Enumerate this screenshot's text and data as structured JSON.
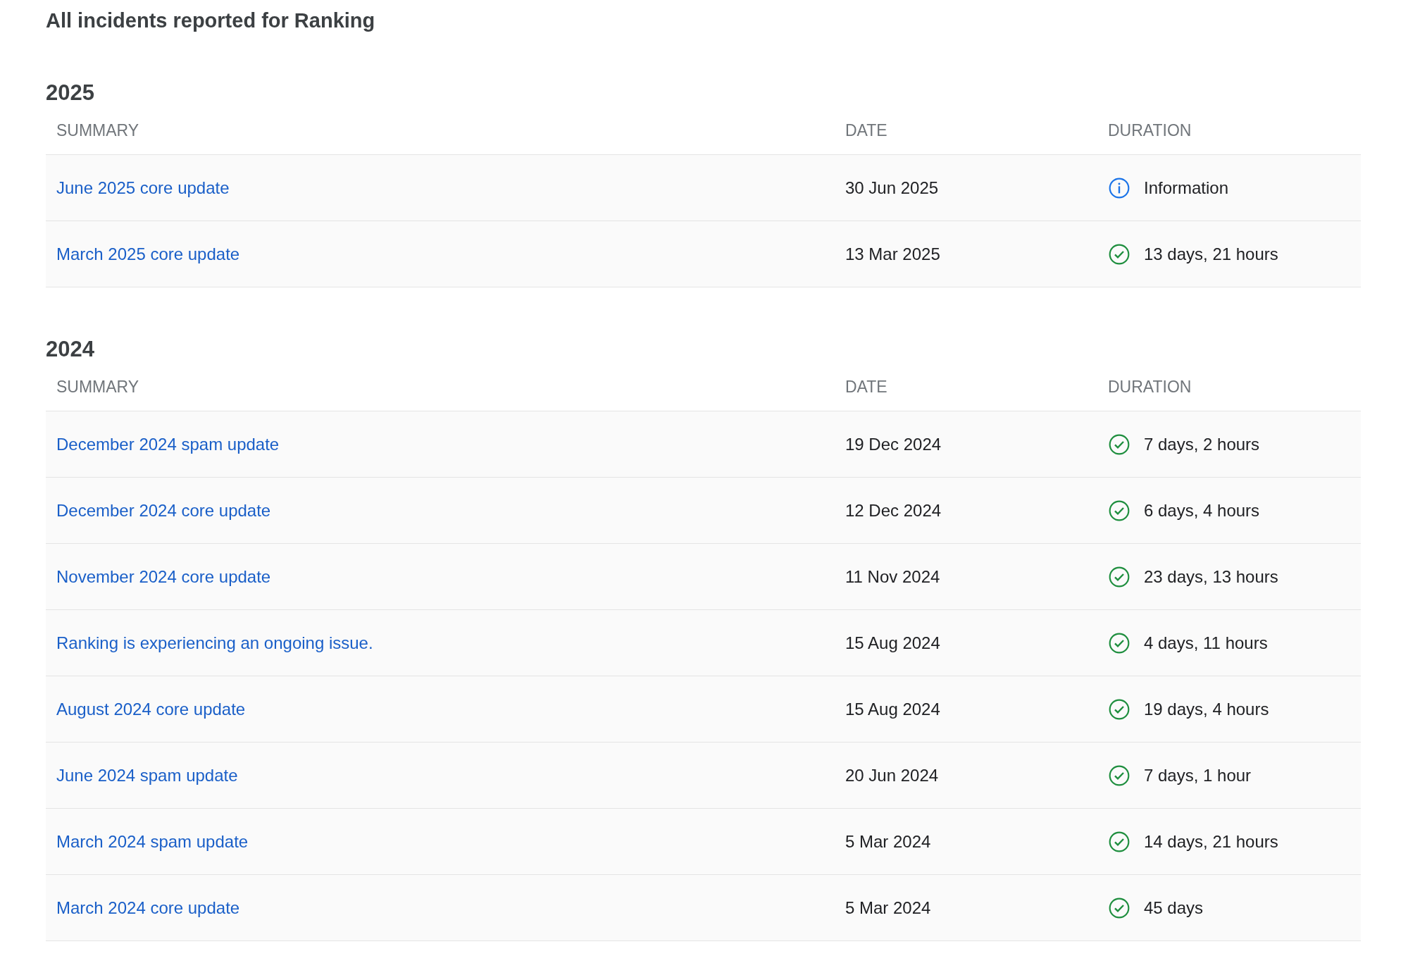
{
  "title": "All incidents reported for Ranking",
  "sections": [
    {
      "year": "2025",
      "columns": [
        "SUMMARY",
        "DATE",
        "DURATION"
      ],
      "rows": [
        {
          "summary": "June 2025 core update",
          "date": "30 Jun 2025",
          "status": {
            "kind": "info",
            "text": "Information"
          }
        },
        {
          "summary": "March 2025 core update",
          "date": "13 Mar 2025",
          "status": {
            "kind": "resolved",
            "text": "13 days, 21 hours"
          }
        }
      ]
    },
    {
      "year": "2024",
      "columns": [
        "SUMMARY",
        "DATE",
        "DURATION"
      ],
      "rows": [
        {
          "summary": "December 2024 spam update",
          "date": "19 Dec 2024",
          "status": {
            "kind": "resolved",
            "text": "7 days, 2 hours"
          }
        },
        {
          "summary": "December 2024 core update",
          "date": "12 Dec 2024",
          "status": {
            "kind": "resolved",
            "text": "6 days, 4 hours"
          }
        },
        {
          "summary": "November 2024 core update",
          "date": "11 Nov 2024",
          "status": {
            "kind": "resolved",
            "text": "23 days, 13 hours"
          }
        },
        {
          "summary": "Ranking is experiencing an ongoing issue.",
          "date": "15 Aug 2024",
          "status": {
            "kind": "resolved",
            "text": "4 days, 11 hours"
          }
        },
        {
          "summary": "August 2024 core update",
          "date": "15 Aug 2024",
          "status": {
            "kind": "resolved",
            "text": "19 days, 4 hours"
          }
        },
        {
          "summary": "June 2024 spam update",
          "date": "20 Jun 2024",
          "status": {
            "kind": "resolved",
            "text": "7 days, 1 hour"
          }
        },
        {
          "summary": "March 2024 spam update",
          "date": "5 Mar 2024",
          "status": {
            "kind": "resolved",
            "text": "14 days, 21 hours"
          }
        },
        {
          "summary": "March 2024 core update",
          "date": "5 Mar 2024",
          "status": {
            "kind": "resolved",
            "text": "45 days"
          }
        }
      ]
    }
  ]
}
